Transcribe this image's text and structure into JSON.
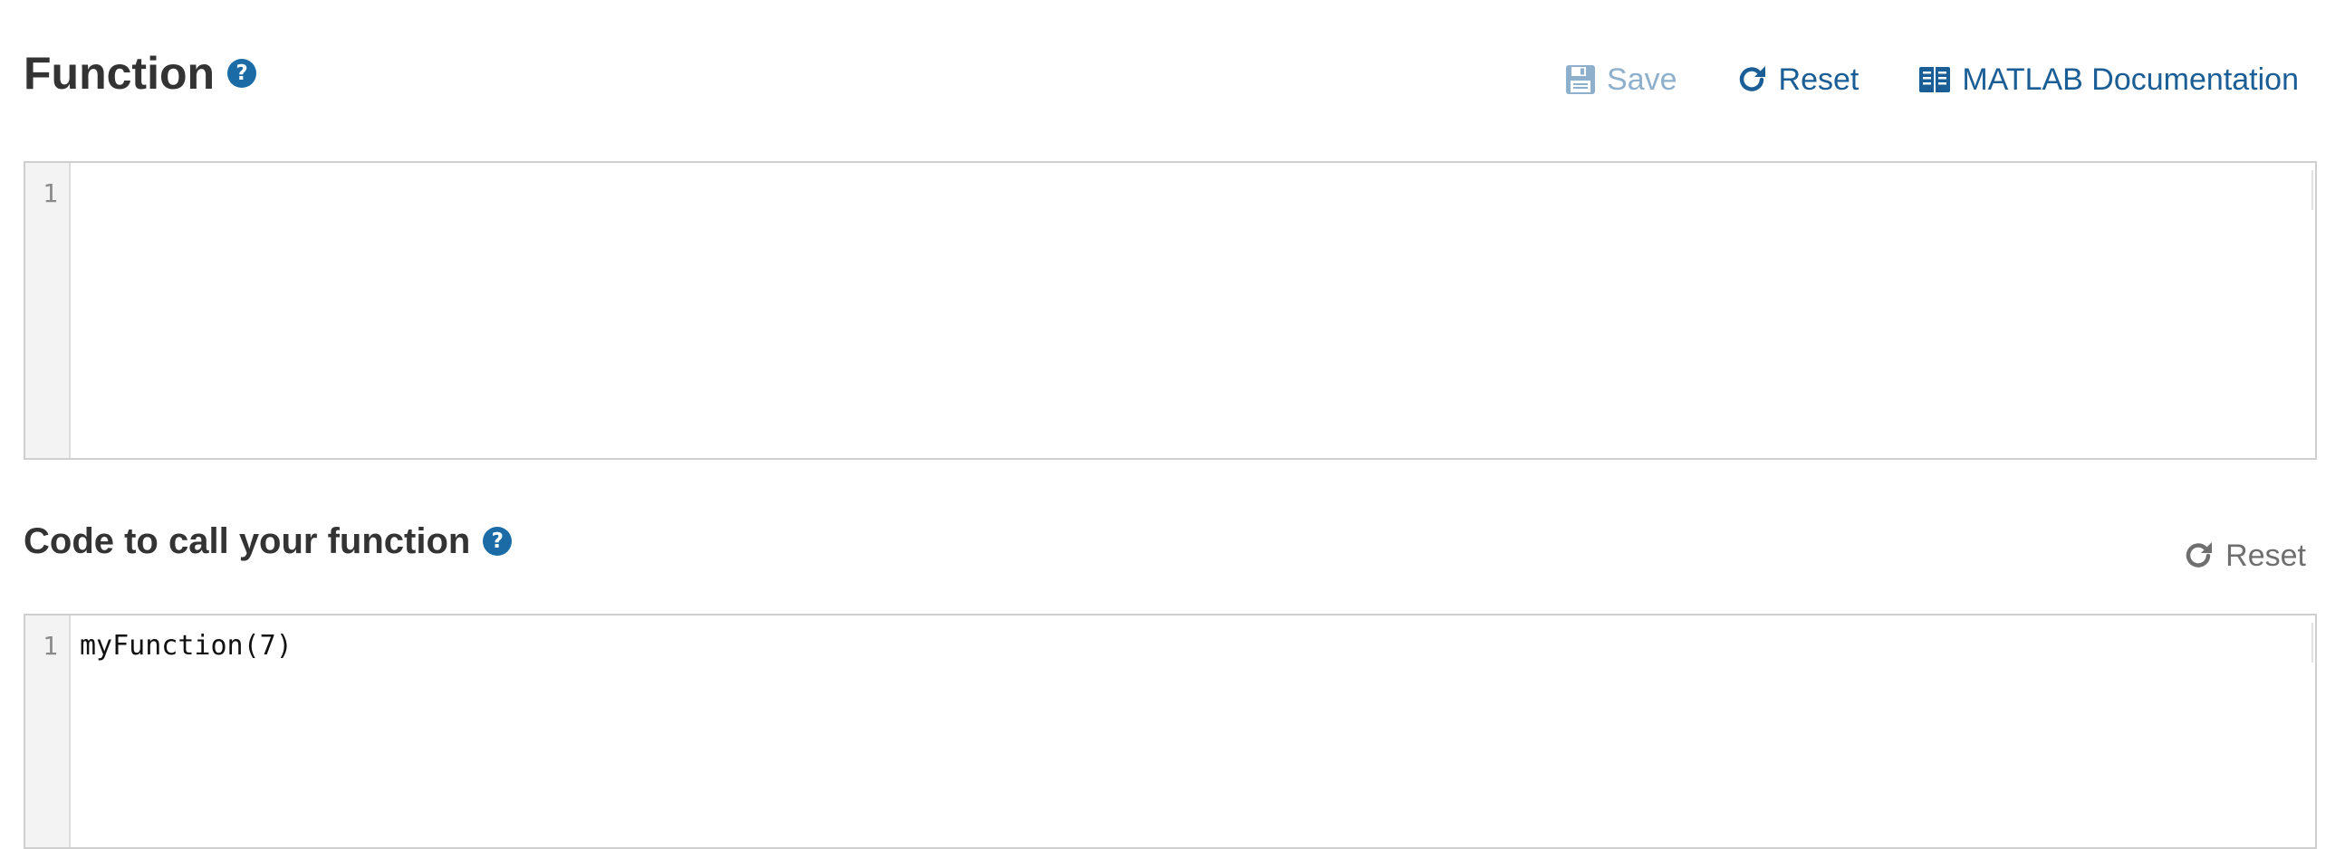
{
  "function_section": {
    "title": "Function",
    "help_icon": "question-circle-icon",
    "toolbar": {
      "save_label": "Save",
      "save_icon": "floppy-disk-icon",
      "reset_label": "Reset",
      "reset_icon": "redo-icon",
      "doc_label": "MATLAB Documentation",
      "doc_icon": "book-icon"
    },
    "editor": {
      "line_numbers": [
        "1"
      ],
      "code": ""
    }
  },
  "call_section": {
    "title": "Code to call your function",
    "help_icon": "question-circle-icon",
    "toolbar": {
      "reset_label": "Reset",
      "reset_icon": "redo-icon"
    },
    "editor": {
      "line_numbers": [
        "1"
      ],
      "code": "myFunction(7)"
    }
  },
  "colors": {
    "accent": "#1b6ca6",
    "link": "#1b5e96",
    "disabled": "#8fb0cc",
    "muted": "#6f6f6f",
    "heading": "#333333"
  }
}
